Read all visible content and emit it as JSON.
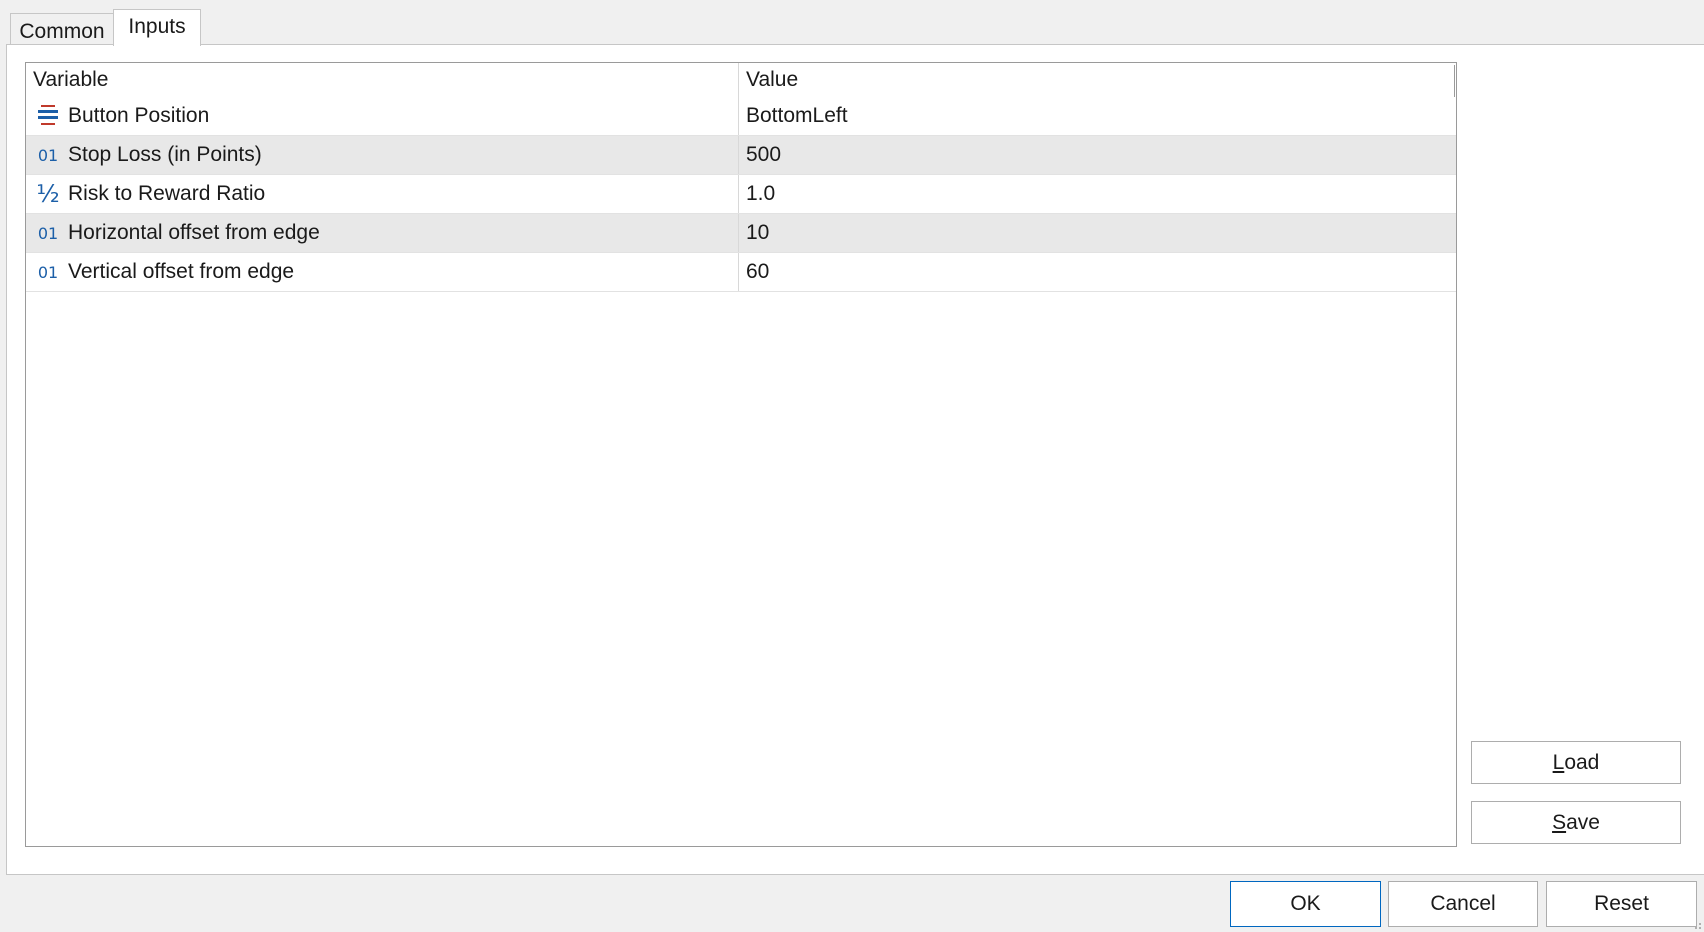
{
  "tabs": [
    {
      "label": "Common",
      "active": false
    },
    {
      "label": "Inputs",
      "active": true
    }
  ],
  "grid": {
    "columns": [
      "Variable",
      "Value"
    ],
    "rows": [
      {
        "icon": "enum-list-icon",
        "variable": "Button Position",
        "value": "BottomLeft"
      },
      {
        "icon": "integer-01-icon",
        "icon_text": "01",
        "variable": "Stop Loss (in Points)",
        "value": "500"
      },
      {
        "icon": "fraction-half-icon",
        "icon_text": "½",
        "variable": "Risk to Reward Ratio",
        "value": "1.0"
      },
      {
        "icon": "integer-01-icon",
        "icon_text": "01",
        "variable": "Horizontal offset from edge",
        "value": "10"
      },
      {
        "icon": "integer-01-icon",
        "icon_text": "01",
        "variable": "Vertical offset from edge",
        "value": "60"
      }
    ]
  },
  "buttons": {
    "load": {
      "accel": "L",
      "rest": "oad"
    },
    "save": {
      "accel": "S",
      "rest": "ave"
    },
    "ok": "OK",
    "cancel": "Cancel",
    "reset": "Reset"
  },
  "colors": {
    "accent": "#0067c0",
    "icon_blue": "#1c5fa8",
    "icon_red": "#c0392b",
    "row_alt": "#e8e8e8"
  }
}
